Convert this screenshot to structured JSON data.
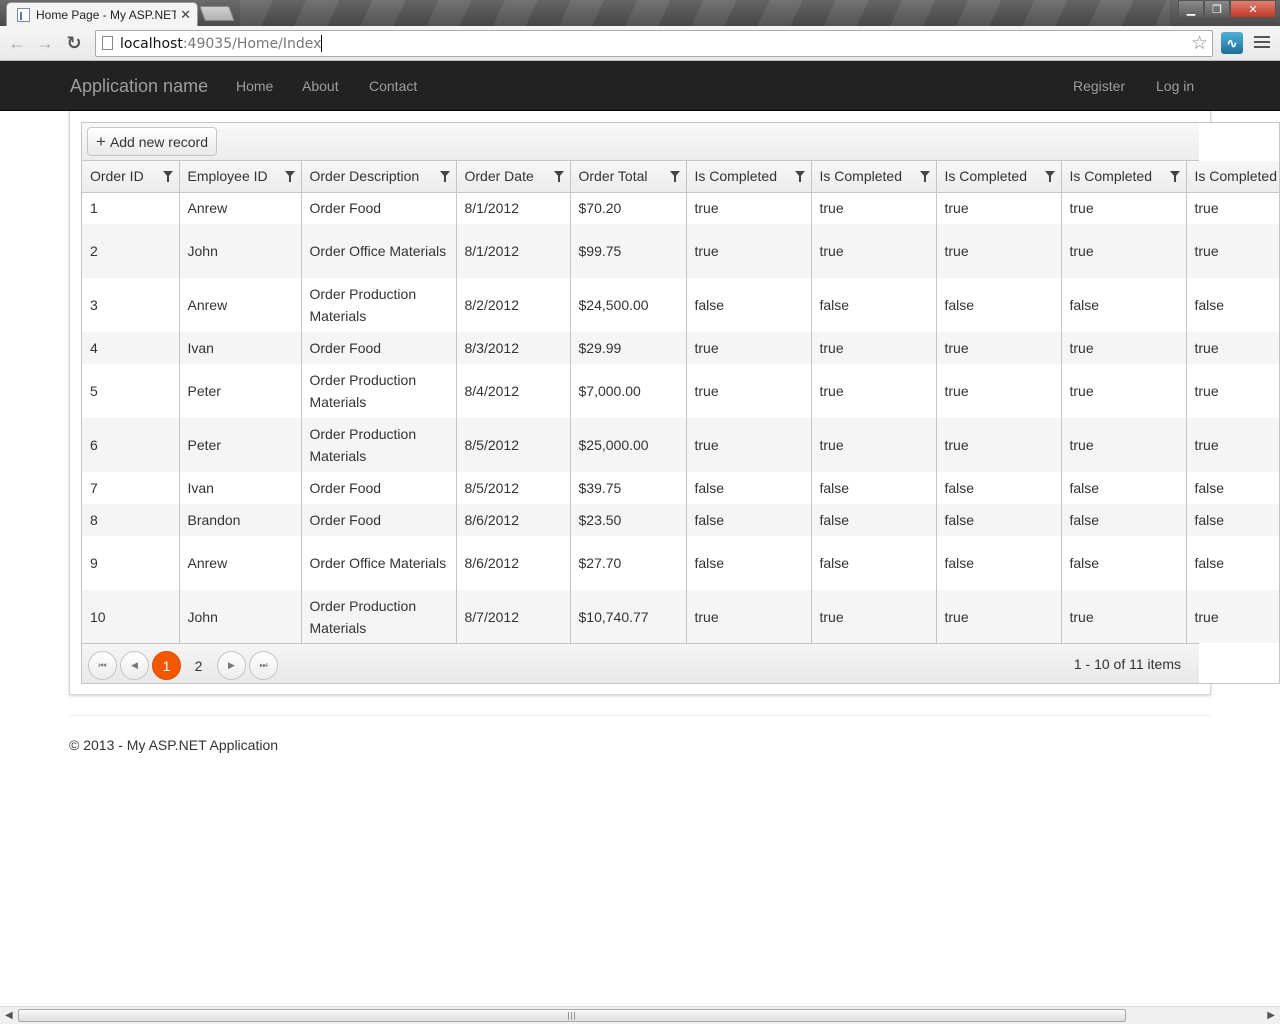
{
  "browser": {
    "tab_title": "Home Page - My ASP.NET",
    "tab_close": "✕",
    "url_host": "localhost",
    "url_path": ":49035/Home/Index",
    "window_controls": {
      "minimize": "▁",
      "maximize": "❐",
      "close": "✕"
    }
  },
  "navbar": {
    "brand": "Application name",
    "links": [
      "Home",
      "About",
      "Contact"
    ],
    "right_links": [
      "Register",
      "Log in"
    ]
  },
  "grid": {
    "add_button_icon": "+",
    "add_button_label": "Add new record",
    "columns": [
      "Order ID",
      "Employee ID",
      "Order Description",
      "Order Date",
      "Order Total",
      "Is Completed",
      "Is Completed",
      "Is Completed",
      "Is Completed",
      "Is Completed"
    ],
    "rows": [
      [
        "1",
        "Anrew",
        "Order Food",
        "8/1/2012",
        "$70.20",
        "true",
        "true",
        "true",
        "true",
        "true"
      ],
      [
        "2",
        "John",
        "Order Office Materials",
        "8/1/2012",
        "$99.75",
        "true",
        "true",
        "true",
        "true",
        "true"
      ],
      [
        "3",
        "Anrew",
        "Order Production Materials",
        "8/2/2012",
        "$24,500.00",
        "false",
        "false",
        "false",
        "false",
        "false"
      ],
      [
        "4",
        "Ivan",
        "Order Food",
        "8/3/2012",
        "$29.99",
        "true",
        "true",
        "true",
        "true",
        "true"
      ],
      [
        "5",
        "Peter",
        "Order Production Materials",
        "8/4/2012",
        "$7,000.00",
        "true",
        "true",
        "true",
        "true",
        "true"
      ],
      [
        "6",
        "Peter",
        "Order Production Materials",
        "8/5/2012",
        "$25,000.00",
        "true",
        "true",
        "true",
        "true",
        "true"
      ],
      [
        "7",
        "Ivan",
        "Order Food",
        "8/5/2012",
        "$39.75",
        "false",
        "false",
        "false",
        "false",
        "false"
      ],
      [
        "8",
        "Brandon",
        "Order Food",
        "8/6/2012",
        "$23.50",
        "false",
        "false",
        "false",
        "false",
        "false"
      ],
      [
        "9",
        "Anrew",
        "Order Office Materials",
        "8/6/2012",
        "$27.70",
        "false",
        "false",
        "false",
        "false",
        "false"
      ],
      [
        "10",
        "John",
        "Order Production Materials",
        "8/7/2012",
        "$10,740.77",
        "true",
        "true",
        "true",
        "true",
        "true"
      ]
    ],
    "pager": {
      "first_icon": "⏮",
      "prev_icon": "◀",
      "next_icon": "▶",
      "last_icon": "⏭",
      "pages": [
        "1",
        "2"
      ],
      "current_page": "1",
      "info": "1 - 10 of 11 items"
    }
  },
  "footer": {
    "text": "© 2013 - My ASP.NET Application"
  },
  "colors": {
    "navbar_bg": "#222222",
    "pager_active": "#f35800"
  }
}
